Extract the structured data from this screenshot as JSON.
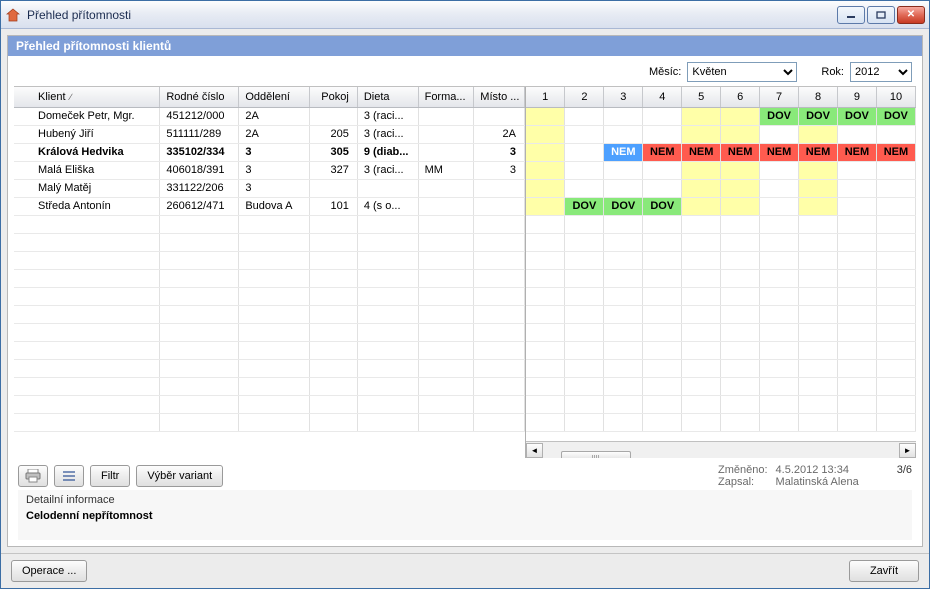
{
  "window": {
    "title": "Přehled přítomnosti"
  },
  "panel": {
    "header": "Přehled přítomnosti klientů"
  },
  "filters": {
    "month_label": "Měsíc:",
    "month_value": "Květen",
    "year_label": "Rok:",
    "year_value": "2012"
  },
  "columns": {
    "klient": "Klient",
    "rc": "Rodné číslo",
    "odd": "Oddělení",
    "pokoj": "Pokoj",
    "dieta": "Dieta",
    "forma": "Forma...",
    "misto": "Místo ..."
  },
  "days": [
    "1",
    "2",
    "3",
    "4",
    "5",
    "6",
    "7",
    "8",
    "9",
    "10"
  ],
  "rows": [
    {
      "klient": "Domeček Petr, Mgr.",
      "rc": "451212/000",
      "odd": "2A",
      "pokoj": "",
      "dieta": "3 (raci...",
      "forma": "",
      "misto": "",
      "bold": false,
      "cells": [
        {
          "t": "",
          "c": "ylw"
        },
        {
          "t": "",
          "c": ""
        },
        {
          "t": "",
          "c": ""
        },
        {
          "t": "",
          "c": ""
        },
        {
          "t": "",
          "c": "ylw"
        },
        {
          "t": "",
          "c": "ylw"
        },
        {
          "t": "DOV",
          "c": "grn"
        },
        {
          "t": "DOV",
          "c": "grn"
        },
        {
          "t": "DOV",
          "c": "grn"
        },
        {
          "t": "DOV",
          "c": "grn"
        }
      ]
    },
    {
      "klient": "Hubený Jiří",
      "rc": "511111/289",
      "odd": "2A",
      "pokoj": "205",
      "dieta": "3 (raci...",
      "forma": "",
      "misto": "2A",
      "bold": false,
      "cells": [
        {
          "t": "",
          "c": "ylw"
        },
        {
          "t": "",
          "c": ""
        },
        {
          "t": "",
          "c": ""
        },
        {
          "t": "",
          "c": ""
        },
        {
          "t": "",
          "c": "ylw"
        },
        {
          "t": "",
          "c": "ylw"
        },
        {
          "t": "",
          "c": ""
        },
        {
          "t": "",
          "c": "ylw"
        },
        {
          "t": "",
          "c": ""
        },
        {
          "t": "",
          "c": ""
        }
      ]
    },
    {
      "klient": "Králová Hedvika",
      "rc": "335102/334",
      "odd": "3",
      "pokoj": "305",
      "dieta": "9 (diab...",
      "forma": "",
      "misto": "3",
      "bold": true,
      "cells": [
        {
          "t": "",
          "c": "ylw"
        },
        {
          "t": "",
          "c": ""
        },
        {
          "t": "NEM",
          "c": "blu"
        },
        {
          "t": "NEM",
          "c": "red"
        },
        {
          "t": "NEM",
          "c": "red"
        },
        {
          "t": "NEM",
          "c": "red"
        },
        {
          "t": "NEM",
          "c": "red"
        },
        {
          "t": "NEM",
          "c": "red"
        },
        {
          "t": "NEM",
          "c": "red"
        },
        {
          "t": "NEM",
          "c": "red"
        }
      ]
    },
    {
      "klient": "Malá Eliška",
      "rc": "406018/391",
      "odd": "3",
      "pokoj": "327",
      "dieta": "3 (raci...",
      "forma": "MM",
      "misto": "3",
      "bold": false,
      "cells": [
        {
          "t": "",
          "c": "ylw"
        },
        {
          "t": "",
          "c": ""
        },
        {
          "t": "",
          "c": ""
        },
        {
          "t": "",
          "c": ""
        },
        {
          "t": "",
          "c": "ylw"
        },
        {
          "t": "",
          "c": "ylw"
        },
        {
          "t": "",
          "c": ""
        },
        {
          "t": "",
          "c": "ylw"
        },
        {
          "t": "",
          "c": ""
        },
        {
          "t": "",
          "c": ""
        }
      ]
    },
    {
      "klient": "Malý Matěj",
      "rc": "331122/206",
      "odd": "3",
      "pokoj": "",
      "dieta": "",
      "forma": "",
      "misto": "",
      "bold": false,
      "cells": [
        {
          "t": "",
          "c": "ylw"
        },
        {
          "t": "",
          "c": ""
        },
        {
          "t": "",
          "c": ""
        },
        {
          "t": "",
          "c": ""
        },
        {
          "t": "",
          "c": "ylw"
        },
        {
          "t": "",
          "c": "ylw"
        },
        {
          "t": "",
          "c": ""
        },
        {
          "t": "",
          "c": "ylw"
        },
        {
          "t": "",
          "c": ""
        },
        {
          "t": "",
          "c": ""
        }
      ]
    },
    {
      "klient": "Středa Antonín",
      "rc": "260612/471",
      "odd": "Budova A",
      "pokoj": "101",
      "dieta": "4 (s o...",
      "forma": "",
      "misto": "",
      "bold": false,
      "cells": [
        {
          "t": "",
          "c": "ylw"
        },
        {
          "t": "DOV",
          "c": "grn"
        },
        {
          "t": "DOV",
          "c": "grn"
        },
        {
          "t": "DOV",
          "c": "grn"
        },
        {
          "t": "",
          "c": "ylw"
        },
        {
          "t": "",
          "c": "ylw"
        },
        {
          "t": "",
          "c": ""
        },
        {
          "t": "",
          "c": "ylw"
        },
        {
          "t": "",
          "c": ""
        },
        {
          "t": "",
          "c": ""
        }
      ]
    }
  ],
  "empty_rows": 12,
  "buttons": {
    "filter": "Filtr",
    "variants": "Výběr variant",
    "operace": "Operace ...",
    "close": "Zavřít"
  },
  "meta": {
    "changed_lbl": "Změněno:",
    "changed_val": "4.5.2012 13:34",
    "wrote_lbl": "Zapsal:",
    "wrote_val": "Malatinská Alena",
    "count": "3/6"
  },
  "detail": {
    "label": "Detailní informace",
    "value": "Celodenní nepřítomnost"
  }
}
